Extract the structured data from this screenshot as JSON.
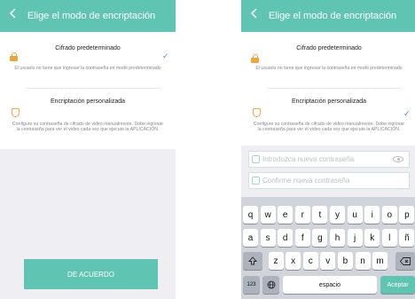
{
  "header": {
    "title": "Elige el modo de encriptación",
    "back_icon": "chevron-left-icon"
  },
  "options": {
    "default": {
      "label": "Cifrado predeterminado",
      "description": "El usuario no tiene que ingresar la contraseña en modo predeterminado"
    },
    "custom": {
      "label": "Encriptación personalizada",
      "description": "Configure su contraseña de cifrado de video manualmente. Debe ingresar la contraseña para ver el video cada vez que ejecute la APLICACIÓN."
    }
  },
  "agree_button": {
    "label": "DE ACUERDO"
  },
  "password": {
    "new_placeholder": "Introduzca nueva contraseña",
    "confirm_placeholder": "Confirme nueva contraseña"
  },
  "keyboard": {
    "row1": [
      "q",
      "w",
      "e",
      "r",
      "t",
      "y",
      "u",
      "i",
      "o",
      "p"
    ],
    "row2": [
      "a",
      "s",
      "d",
      "f",
      "g",
      "h",
      "j",
      "k",
      "l",
      "ñ"
    ],
    "row3": [
      "z",
      "x",
      "c",
      "v",
      "b",
      "n",
      "m"
    ],
    "numbers_key": "123",
    "space_key": "espacio",
    "accept_key": "Aceptar",
    "shift_icon": "shift-icon",
    "backspace_icon": "backspace-icon",
    "globe_icon": "globe-icon"
  },
  "colors": {
    "accent": "#5fc4b2",
    "lock": "#f0a43a",
    "check": "#3c8fe0"
  }
}
